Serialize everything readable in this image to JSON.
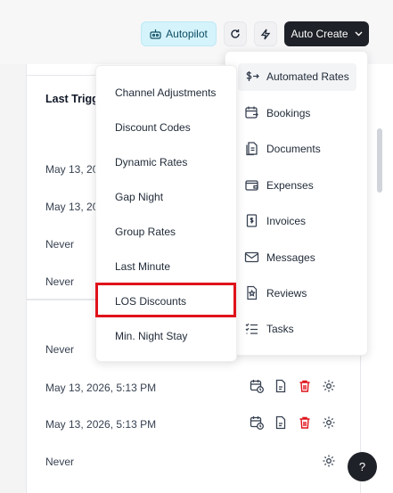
{
  "toolbar": {
    "autopilot_label": "Autopilot",
    "create_label": "Auto Create"
  },
  "table": {
    "header": "Last Trigg",
    "rows": [
      "May 13, 2026",
      "May 13, 2026",
      "Never",
      "Never",
      "Never",
      "May 13, 2026, 5:13 PM",
      "May 13, 2026, 5:13 PM",
      "Never"
    ]
  },
  "menu_left": {
    "items": [
      "Channel Adjustments",
      "Discount Codes",
      "Dynamic Rates",
      "Gap Night",
      "Group Rates",
      "Last Minute",
      "LOS Discounts",
      "Min. Night Stay"
    ]
  },
  "menu_right": {
    "items": [
      "Automated Rates",
      "Bookings",
      "Documents",
      "Expenses",
      "Invoices",
      "Messages",
      "Reviews",
      "Tasks"
    ],
    "icons": [
      "dollar-arrows-icon",
      "calendar-icon",
      "documents-icon",
      "wallet-icon",
      "invoice-icon",
      "mail-icon",
      "review-star-icon",
      "tasks-list-icon"
    ]
  },
  "help_label": "?",
  "colors": {
    "accent_red": "#e0121b",
    "dark_button": "#1f2128",
    "autopilot_bg": "#d4f3fb"
  }
}
